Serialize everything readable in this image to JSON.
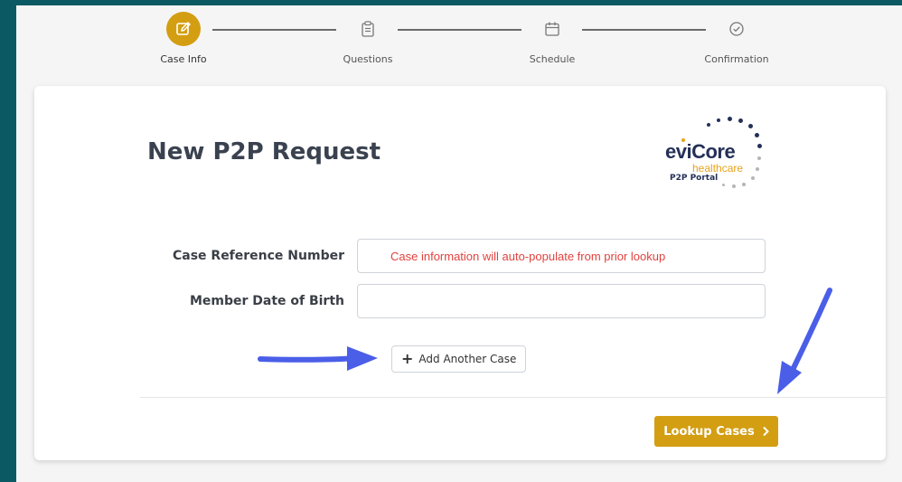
{
  "stepper": {
    "steps": [
      {
        "label": "Case Info",
        "icon": "edit-icon",
        "active": true
      },
      {
        "label": "Questions",
        "icon": "clipboard-icon",
        "active": false
      },
      {
        "label": "Schedule",
        "icon": "calendar-icon",
        "active": false
      },
      {
        "label": "Confirmation",
        "icon": "check-circle-icon",
        "active": false
      }
    ]
  },
  "card": {
    "title": "New P2P Request",
    "logo": {
      "brand": "eviCore",
      "sub": "healthcare",
      "portal": "P2P Portal"
    },
    "fields": {
      "case_ref_label": "Case Reference Number",
      "case_ref_placeholder": "Case information will auto-populate from prior lookup",
      "dob_label": "Member Date of Birth",
      "dob_value": ""
    },
    "add_case_label": "Add Another Case",
    "lookup_label": "Lookup Cases"
  },
  "colors": {
    "accent": "#d39e12",
    "background": "#0b5a63",
    "annotation_arrow": "#4a5ee8",
    "placeholder": "#e0433f"
  }
}
